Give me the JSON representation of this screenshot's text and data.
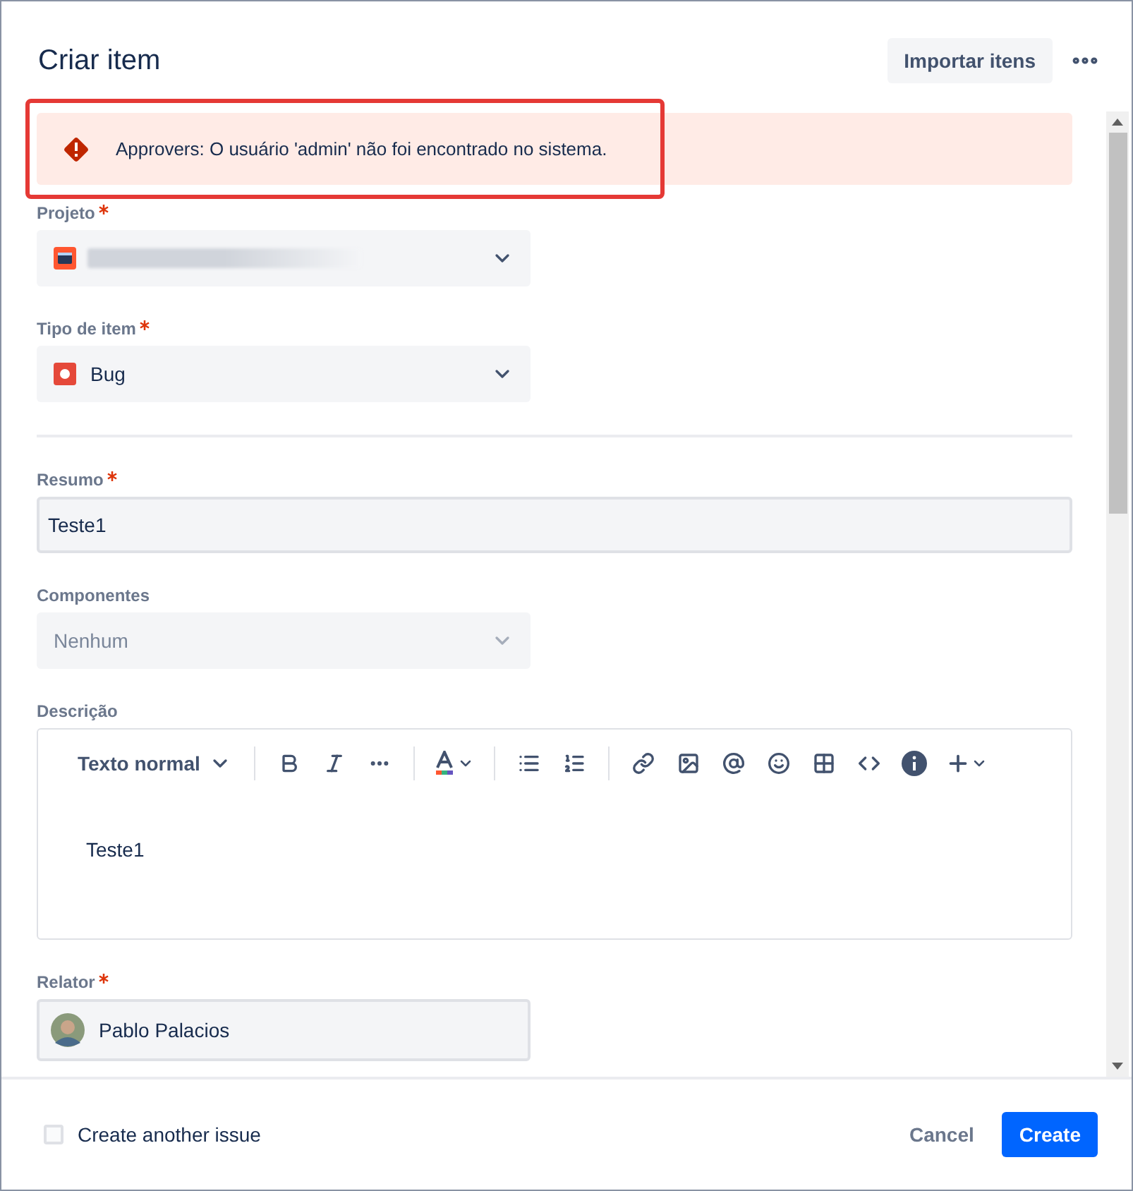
{
  "dialog": {
    "title": "Criar item",
    "import_button": "Importar itens"
  },
  "error_banner": {
    "message": "Approvers: O usuário 'admin' não foi encontrado no sistema.",
    "highlighted": true
  },
  "fields": [
    {
      "kind": "project",
      "label": "Projeto",
      "required": true
    },
    {
      "kind": "issuetype",
      "label": "Tipo de item",
      "required": true,
      "value": "Bug"
    },
    {
      "kind": "divider"
    },
    {
      "kind": "text",
      "label": "Resumo",
      "required": true,
      "value": "Teste1"
    },
    {
      "kind": "select",
      "label": "Componentes",
      "required": false,
      "value": "Nenhum",
      "disabled": true
    },
    {
      "kind": "editor",
      "label": "Descrição",
      "required": false,
      "text_style": "Texto normal",
      "value": "Teste1"
    },
    {
      "kind": "user",
      "label": "Relator",
      "required": true,
      "value": "Pablo Palacios"
    }
  ],
  "footer": {
    "create_another": {
      "label": "Create another issue",
      "checked": false
    },
    "cancel_button": "Cancel",
    "create_button": "Create"
  }
}
